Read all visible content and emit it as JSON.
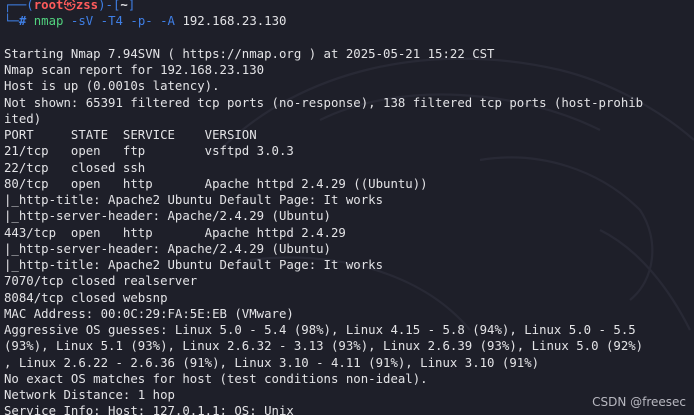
{
  "prompt": {
    "box_open": "┌──(",
    "user": "root",
    "skull": "㉿",
    "host": "zss",
    "sep": ")-[",
    "dir": "~",
    "box_close": "]",
    "line2_prefix": "└─",
    "hash": "#",
    "command": "nmap",
    "args": [
      "-sV",
      "-T4",
      "-p-",
      "-A"
    ],
    "target": "192.168.23.130"
  },
  "output_lines": [
    "",
    "Starting Nmap 7.94SVN ( https://nmap.org ) at 2025-05-21 15:22 CST",
    "Nmap scan report for 192.168.23.130",
    "Host is up (0.0010s latency).",
    "Not shown: 65391 filtered tcp ports (no-response), 138 filtered tcp ports (host-prohib",
    "ited)",
    "PORT     STATE  SERVICE    VERSION",
    "21/tcp   open   ftp        vsftpd 3.0.3",
    "22/tcp   closed ssh",
    "80/tcp   open   http       Apache httpd 2.4.29 ((Ubuntu))",
    "|_http-title: Apache2 Ubuntu Default Page: It works",
    "|_http-server-header: Apache/2.4.29 (Ubuntu)",
    "443/tcp  open   http       Apache httpd 2.4.29",
    "|_http-server-header: Apache/2.4.29 (Ubuntu)",
    "|_http-title: Apache2 Ubuntu Default Page: It works",
    "7070/tcp closed realserver",
    "8084/tcp closed websnp",
    "MAC Address: 00:0C:29:FA:5E:EB (VMware)",
    "Aggressive OS guesses: Linux 5.0 - 5.4 (98%), Linux 4.15 - 5.8 (94%), Linux 5.0 - 5.5",
    "(93%), Linux 5.1 (93%), Linux 2.6.32 - 3.13 (93%), Linux 2.6.39 (93%), Linux 5.0 (92%)",
    ", Linux 2.6.22 - 2.6.36 (91%), Linux 3.10 - 4.11 (91%), Linux 3.10 (91%)",
    "No exact OS matches for host (test conditions non-ideal).",
    "Network Distance: 1 hop",
    "Service Info: Host: 127.0.1.1; OS: Unix"
  ],
  "watermark": "CSDN @freesec",
  "colors": {
    "background": "#1e1f29",
    "text": "#e3e3e6",
    "prompt_blue": "#3f7fe6",
    "user_red": "#ff5b5b",
    "command_green": "#51d17e"
  }
}
